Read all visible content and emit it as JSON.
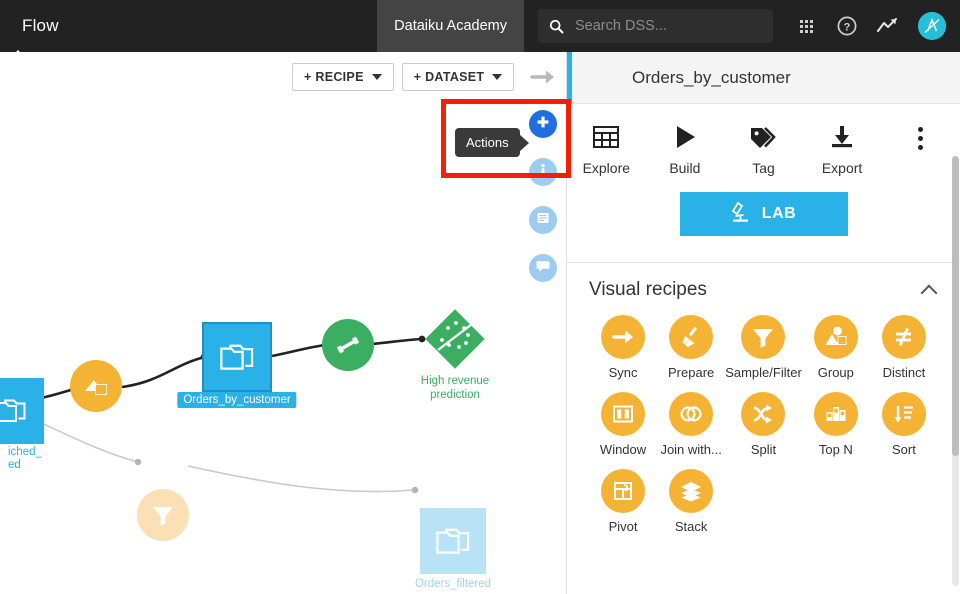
{
  "topbar": {
    "title": "Flow",
    "academy_tab": "Dataiku Academy",
    "search": {
      "placeholder": "Search DSS...",
      "value": ""
    },
    "icons": {
      "search": "search-icon",
      "apps_grid": "apps-grid-icon",
      "help": "help-icon",
      "trending": "trending-chart-icon",
      "avatar_initial": "A"
    }
  },
  "flow": {
    "toolbar": {
      "recipe_button": "+ RECIPE",
      "dataset_button": "+ DATASET"
    },
    "nodes": [
      {
        "id": "orders_enriched",
        "label": "iched_\ned",
        "type": "dataset",
        "state": "partial"
      },
      {
        "id": "join_recipe",
        "label": "",
        "type": "recipe-join",
        "color": "#f5b335"
      },
      {
        "id": "orders_by_customer",
        "label": "Orders_by_customer",
        "type": "dataset",
        "state": "selected"
      },
      {
        "id": "train_recipe",
        "label": "",
        "type": "recipe-train",
        "color": "#3cae62"
      },
      {
        "id": "high_revenue_prediction",
        "label": "High revenue\nprediction",
        "type": "model",
        "color": "#3cae62"
      },
      {
        "id": "filter_recipe",
        "label": "",
        "type": "recipe-filter",
        "color": "#fae0b4"
      },
      {
        "id": "orders_filtered",
        "label": "Orders_filtered",
        "type": "dataset",
        "state": "dimmed"
      }
    ],
    "node_labels": {
      "orders_enriched_line1": "iched_",
      "orders_enriched_line2": "ed",
      "orders_by_customer": "Orders_by_customer",
      "prediction_line1": "High revenue",
      "prediction_line2": "prediction",
      "orders_filtered": "Orders_filtered"
    }
  },
  "strip": {
    "arrow": "collapse-arrow-icon",
    "items": [
      {
        "name": "actions",
        "icon": "plus-icon",
        "active": true
      },
      {
        "name": "details",
        "icon": "info-icon",
        "active": false
      },
      {
        "name": "summary",
        "icon": "list-icon",
        "active": false
      },
      {
        "name": "discussions",
        "icon": "chat-icon",
        "active": false
      }
    ]
  },
  "tooltip": {
    "text": "Actions"
  },
  "highlight": {
    "color": "#f81d09"
  },
  "panel": {
    "header": {
      "icon": "folder-icon",
      "title": "Orders_by_customer"
    },
    "actions": [
      {
        "label": "Explore",
        "icon": "table-icon"
      },
      {
        "label": "Build",
        "icon": "play-icon"
      },
      {
        "label": "Tag",
        "icon": "tag-icon"
      },
      {
        "label": "Export",
        "icon": "download-icon"
      },
      {
        "label": "",
        "icon": "kebab-menu-icon"
      }
    ],
    "lab_button": {
      "label": "LAB",
      "icon": "microscope-icon",
      "color": "#2ab1e8"
    },
    "visual_recipes": {
      "title": "Visual recipes",
      "collapse_icon": "chevron-up-icon",
      "items": [
        {
          "label": "Sync",
          "icon": "arrow-right-icon"
        },
        {
          "label": "Prepare",
          "icon": "broom-icon"
        },
        {
          "label": "Sample/Filter",
          "icon": "funnel-icon"
        },
        {
          "label": "Group",
          "icon": "shapes-icon"
        },
        {
          "label": "Distinct",
          "icon": "not-equal-icon"
        },
        {
          "label": "Window",
          "icon": "columns-icon"
        },
        {
          "label": "Join with...",
          "icon": "venn-icon"
        },
        {
          "label": "Split",
          "icon": "split-arrows-icon"
        },
        {
          "label": "Top N",
          "icon": "podium-icon"
        },
        {
          "label": "Sort",
          "icon": "sort-down-icon"
        },
        {
          "label": "Pivot",
          "icon": "pivot-icon"
        },
        {
          "label": "Stack",
          "icon": "layers-icon"
        }
      ]
    }
  }
}
